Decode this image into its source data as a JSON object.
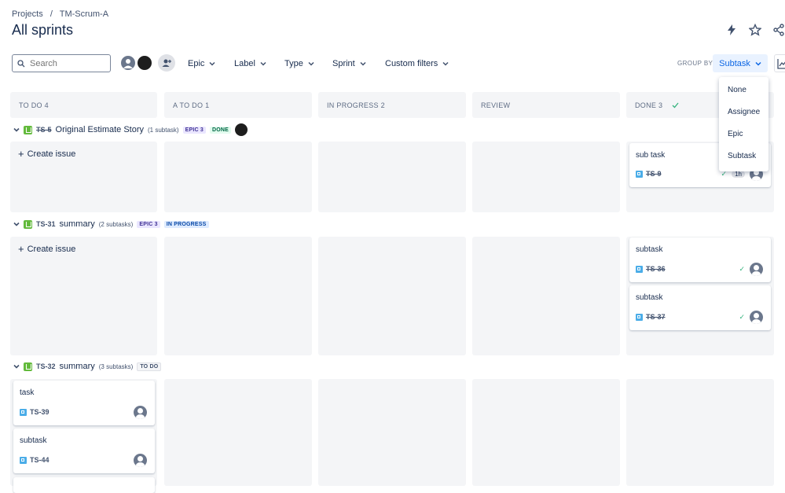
{
  "breadcrumb": {
    "projects": "Projects",
    "sep": "/",
    "project": "TM-Scrum-A"
  },
  "page_title": "All sprints",
  "search": {
    "placeholder": "Search",
    "value": ""
  },
  "filters": {
    "epic": "Epic",
    "label": "Label",
    "type": "Type",
    "sprint": "Sprint",
    "custom": "Custom filters"
  },
  "group_by": {
    "label": "GROUP BY",
    "value": "Subtask"
  },
  "group_menu": [
    "None",
    "Assignee",
    "Epic",
    "Subtask"
  ],
  "columns": [
    "TO DO 4",
    "A TO DO 1",
    "IN PROGRESS 2",
    "REVIEW",
    "DONE 3"
  ],
  "swimlanes": [
    {
      "key": "TS-5",
      "title": "Original Estimate Story",
      "subtasks": "(1 subtask)",
      "epic": "EPIC 3",
      "status": "DONE",
      "create": "Create issue",
      "done_cards": [
        {
          "title": "sub task",
          "key": "TS-9",
          "estimate": "1h"
        }
      ]
    },
    {
      "key": "TS-31",
      "title": "summary",
      "subtasks": "(2 subtasks)",
      "epic": "EPIC 3",
      "status": "IN PROGRESS",
      "create": "Create issue",
      "done_cards": [
        {
          "title": "subtask",
          "key": "TS-36"
        },
        {
          "title": "subtask",
          "key": "TS-37"
        }
      ]
    },
    {
      "key": "TS-32",
      "title": "summary",
      "subtasks": "(3 subtasks)",
      "status": "TO DO",
      "todo_cards": [
        {
          "title": "task",
          "key": "TS-39"
        },
        {
          "title": "subtask",
          "key": "TS-44"
        }
      ]
    }
  ],
  "colors": {
    "accent": "#0c66e4",
    "story": "#63ba3c",
    "subtask": "#4bade8",
    "done_check": "#36b37e"
  }
}
